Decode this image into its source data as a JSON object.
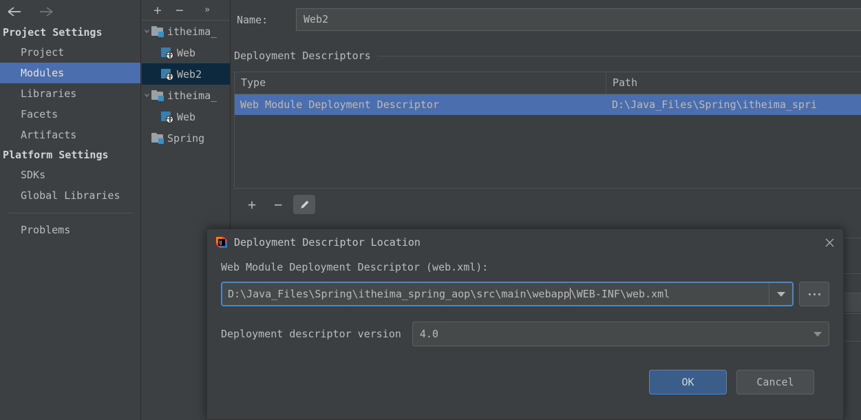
{
  "app": {
    "theme_bg": "#3c3f41",
    "accent_blue": "#4b6eaf",
    "selection_navy": "#0d293e",
    "focus_border": "#4a88c7"
  },
  "nav": {
    "back_icon": "arrow-left-icon",
    "forward_icon": "arrow-right-icon"
  },
  "sidebar": {
    "sections": [
      {
        "title": "Project Settings",
        "items": [
          {
            "label": "Project",
            "selected": false
          },
          {
            "label": "Modules",
            "selected": true
          },
          {
            "label": "Libraries",
            "selected": false
          },
          {
            "label": "Facets",
            "selected": false
          },
          {
            "label": "Artifacts",
            "selected": false
          }
        ]
      },
      {
        "title": "Platform Settings",
        "items": [
          {
            "label": "SDKs",
            "selected": false
          },
          {
            "label": "Global Libraries",
            "selected": false
          }
        ]
      }
    ],
    "footer_items": [
      {
        "label": "Problems"
      }
    ]
  },
  "tree": {
    "toolbar": {
      "add_label": "+",
      "remove_label": "−",
      "more_label": "»"
    },
    "rows": [
      {
        "label": "itheima_",
        "icon": "module-folder-icon",
        "level": 0,
        "expanded": true,
        "selected": false
      },
      {
        "label": "Web",
        "icon": "web-facet-icon",
        "level": 1,
        "expanded": false,
        "selected": false
      },
      {
        "label": "Web2",
        "icon": "web-facet-icon",
        "level": 1,
        "expanded": false,
        "selected": true
      },
      {
        "label": "itheima_",
        "icon": "module-folder-icon",
        "level": 0,
        "expanded": true,
        "selected": false
      },
      {
        "label": "Web",
        "icon": "web-facet-icon",
        "level": 1,
        "expanded": false,
        "selected": false
      },
      {
        "label": "Spring",
        "icon": "module-folder-icon",
        "level": 0,
        "expanded": false,
        "selected": false
      }
    ]
  },
  "main": {
    "name_label": "Name:",
    "name_value": "Web2",
    "section_title": "Deployment Descriptors",
    "table": {
      "columns": [
        "Type",
        "Path"
      ],
      "rows": [
        {
          "type": "Web Module Deployment Descriptor",
          "path": "D:\\Java_Files\\Spring\\itheima_spri",
          "selected": true
        }
      ]
    },
    "table_toolbar": {
      "add_label": "+",
      "remove_label": "−",
      "edit_icon": "pencil-edit-icon"
    }
  },
  "dialog": {
    "icon": "intellij-idea-icon",
    "title": "Deployment Descriptor Location",
    "close_icon": "close-icon",
    "field_label": "Web Module Deployment Descriptor (web.xml):",
    "path_value_before_caret": "D:\\Java_Files\\Spring\\itheima_spring_aop\\src\\main\\webapp",
    "path_value_after_caret": "\\WEB-INF\\web.xml",
    "path_full_value": "D:\\Java_Files\\Spring\\itheima_spring_aop\\src\\main\\webapp\\WEB-INF\\web.xml",
    "path_dropdown_icon": "chevron-down-icon",
    "browse_label": "...",
    "version_label": "Deployment descriptor version",
    "version_value": "4.0",
    "version_dropdown_icon": "chevron-down-icon",
    "ok_label": "OK",
    "cancel_label": "Cancel"
  }
}
